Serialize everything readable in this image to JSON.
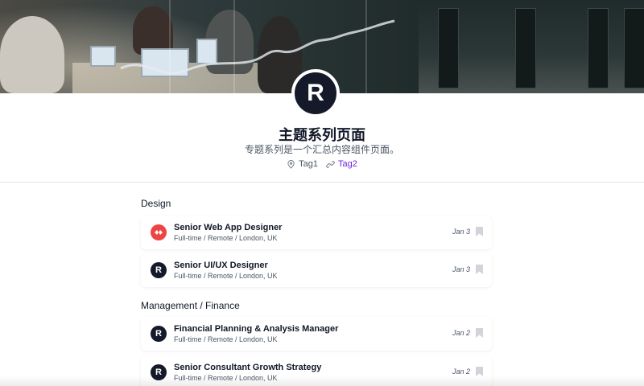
{
  "header": {
    "avatar_letter": "R",
    "title": "主题系列页面",
    "subtitle": "专题系列是一个汇总内容组件页面。",
    "tags": [
      {
        "label": "Tag1",
        "icon": "location-pin-icon"
      },
      {
        "label": "Tag2",
        "icon": "link-icon"
      }
    ]
  },
  "sections": [
    {
      "title": "Design",
      "jobs": [
        {
          "title": "Senior Web App Designer",
          "meta": "Full-time / Remote / London, UK",
          "date": "Jan 3",
          "logo": "brand-red"
        },
        {
          "title": "Senior UI/UX Designer",
          "meta": "Full-time / Remote / London, UK",
          "date": "Jan 3",
          "logo": "R"
        }
      ]
    },
    {
      "title": "Management / Finance",
      "jobs": [
        {
          "title": "Financial Planning & Analysis Manager",
          "meta": "Full-time / Remote / London, UK",
          "date": "Jan 2",
          "logo": "R"
        },
        {
          "title": "Senior Consultant Growth Strategy",
          "meta": "Full-time / Remote / London, UK",
          "date": "Jan 2",
          "logo": "R"
        }
      ]
    }
  ],
  "colors": {
    "accent": "#6d28d9",
    "brand_dark": "#141a2a",
    "brand_red": "#ef4444"
  }
}
